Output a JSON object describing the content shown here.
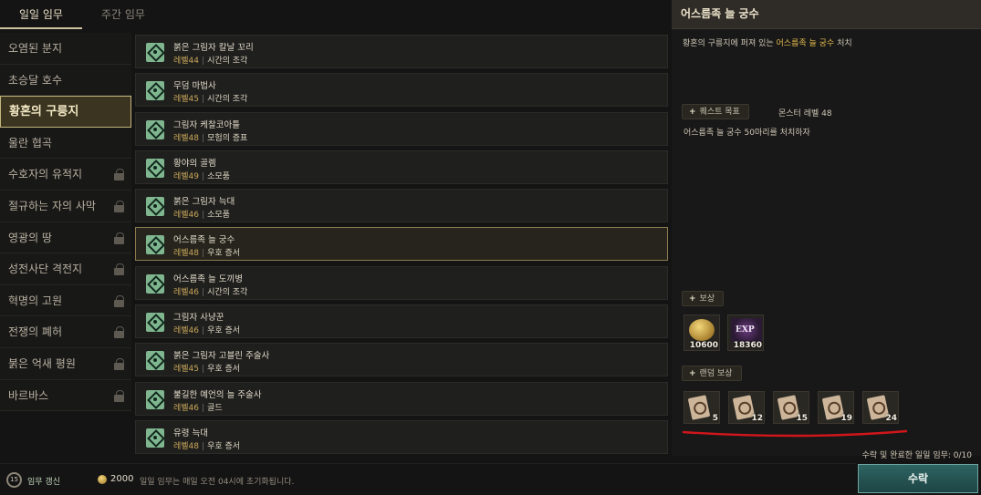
{
  "tabs": [
    {
      "label": "일일 임무",
      "active": true
    },
    {
      "label": "주간 임무",
      "active": false
    }
  ],
  "sidebar": {
    "items": [
      {
        "label": "오염된 분지",
        "locked": false,
        "active": false
      },
      {
        "label": "초승달 호수",
        "locked": false,
        "active": false
      },
      {
        "label": "황혼의 구릉지",
        "locked": false,
        "active": true
      },
      {
        "label": "울란 협곡",
        "locked": false,
        "active": false
      },
      {
        "label": "수호자의 유적지",
        "locked": true,
        "active": false
      },
      {
        "label": "절규하는 자의 사막",
        "locked": true,
        "active": false
      },
      {
        "label": "영광의 땅",
        "locked": true,
        "active": false
      },
      {
        "label": "성전사단 격전지",
        "locked": true,
        "active": false
      },
      {
        "label": "혁명의 고원",
        "locked": true,
        "active": false
      },
      {
        "label": "전쟁의 폐허",
        "locked": true,
        "active": false
      },
      {
        "label": "붉은 억새 평원",
        "locked": true,
        "active": false
      },
      {
        "label": "바르바스",
        "locked": true,
        "active": false
      }
    ]
  },
  "quests": [
    {
      "name": "붉은 그림자 칼날 꼬리",
      "level": "레벨44",
      "reward": "시간의 조각",
      "active": false
    },
    {
      "name": "무덤 마법사",
      "level": "레벨45",
      "reward": "시간의 조각",
      "active": false
    },
    {
      "name": "그림자 케찰코아틀",
      "level": "레벨48",
      "reward": "모험의 증표",
      "active": false
    },
    {
      "name": "황야의 골렘",
      "level": "레벨49",
      "reward": "소모품",
      "active": false
    },
    {
      "name": "붉은 그림자 늑대",
      "level": "레벨46",
      "reward": "소모품",
      "active": false
    },
    {
      "name": "어스름족 늘 궁수",
      "level": "레벨48",
      "reward": "우호 증서",
      "active": true
    },
    {
      "name": "어스름족 늘 도끼병",
      "level": "레벨46",
      "reward": "시간의 조각",
      "active": false
    },
    {
      "name": "그림자 사냥꾼",
      "level": "레벨46",
      "reward": "우호 증서",
      "active": false
    },
    {
      "name": "붉은 그림자 고블린 주술사",
      "level": "레벨45",
      "reward": "우호 증서",
      "active": false
    },
    {
      "name": "불길한 예언의 늘 주술사",
      "level": "레벨46",
      "reward": "골드",
      "active": false
    },
    {
      "name": "유령 늑대",
      "level": "레벨48",
      "reward": "우호 증서",
      "active": false
    }
  ],
  "detail": {
    "title": "어스름족 늘 궁수",
    "desc_prefix": "황혼의 구릉지에 퍼져 있는 ",
    "desc_highlight": "어스름족 늘 궁수",
    "desc_suffix": " 처치",
    "objective_label": "퀘스트 목표",
    "objective_meta": "몬스터 레벨 48",
    "objective_desc": "어스름족 늘 궁수 50마리를 처치하자",
    "reward_label": "보상",
    "rewards": [
      {
        "icon": "gold-coin-icon",
        "count": "10600"
      },
      {
        "icon": "exp-icon",
        "icon_text": "EXP",
        "count": "18360"
      }
    ],
    "random_reward_label": "랜덤 보상",
    "random_rewards": [
      {
        "icon": "scroll-icon",
        "count": "5"
      },
      {
        "icon": "scroll-icon",
        "count": "12"
      },
      {
        "icon": "scroll-icon",
        "count": "15"
      },
      {
        "icon": "scroll-icon",
        "count": "19"
      },
      {
        "icon": "scroll-icon",
        "count": "24"
      }
    ],
    "annotation_color": "#d0161b"
  },
  "footer": {
    "done_count": "수락 및 완료한 일일 임무: 0/10",
    "accept_label": "수락",
    "refresh_count": "15",
    "refresh_label": "임무 갱신",
    "cost": "2000",
    "reset_note": "일일 임무는 매일 오전 04시에 초기화됩니다."
  }
}
